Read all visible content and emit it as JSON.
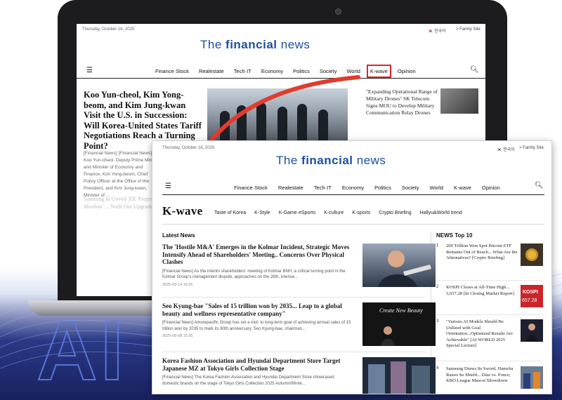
{
  "page_background": "#ffffff",
  "hero_overlay_text": "AI",
  "back_page": {
    "date": "Thursday, October 16, 2025",
    "lang": "🇰🇷 한국어",
    "family": "> Family Site",
    "logo_light": "The",
    "logo_bold": "financial",
    "logo_end": "news",
    "menu": [
      "Finance·Stock",
      "Realestate",
      "Tech·IT",
      "Economy",
      "Politics",
      "Society",
      "World",
      "K-wave",
      "Opinion"
    ],
    "selected_menu": "K-wave",
    "headline": "Koo Yun-cheol, Kim Yong-beom, and Kim Jung-kwan Visit the U.S. in Succession: Will Korea-United States Tariff Negotiations Reach a Turning Point?",
    "snippet": "[Financial News] [Financial News] Koo Yun-cheol, Deputy Prime Minister and Minister of Economy and Finance, Kim Yong-beom, Chief Policy Officer at the Office of the President, and Kim Jung-kwan, Minister of ...",
    "second_headline": "Samsung to Unveil XR 'Project Moohan' ... Nods Out Upgrade",
    "right_story": "\"Expanding Operational Range of Military Drones\" SK Telecom Signs MOU to Develop Military Communication Relay Drones"
  },
  "front_page": {
    "date": "Thursday, October 16, 2025",
    "lang": "🇰🇷 한국어",
    "family": "> Family Site",
    "logo_light": "The",
    "logo_bold": "financial",
    "logo_end": "news",
    "menu": [
      "Finance·Stock",
      "Realestate",
      "Tech·IT",
      "Economy",
      "Politics",
      "Society",
      "World",
      "K-wave",
      "Opinion"
    ],
    "section_title": "K-wave",
    "submenu": [
      "Taste of Korea",
      "K-Style",
      "K-Game·eSports",
      "K-culture",
      "K-sports",
      "Crypto Briefing",
      "Hallyu&World trend"
    ],
    "latest_label": "Latest News",
    "top_label": "NEWS Top 10",
    "latest": [
      {
        "title": "The 'Hostile M&A' Emerges in the Kolmar Incident, Strategic Moves Intensify Ahead of Shareholders' Meeting.. Concerns Over Physical Clashes",
        "summary": "[Financial News] As the interim shareholders' meeting of Kolmar BNH, a critical turning point in the Kolmar Group's management dispute, approaches on the 26th, intense...",
        "date": "2025-09-14 16:26"
      },
      {
        "title": "Seo Kyung-bae \"Sales of 15 trillion won by 2035... Leap to a global beauty and wellness representative company\"",
        "summary": "[Financial News] Amorepacific Group has set a mid- to long-term goal of achieving annual sales of 15 trillion won by 2035 to mark its 80th anniversary. Seo Kyung-bae, chairman...",
        "date": "2025-09-08 15:35"
      },
      {
        "title": "Korea Fashion Association and Hyundai Department Store Target Japanese MZ at Tokyo Girls Collection Stage",
        "summary": "[Financial News] The Korea Fashion Association and Hyundai Department Store showcased domestic brands on the stage of Tokyo Girls Collection 2025 Autumn/Winte...",
        "date": ""
      }
    ],
    "creative_caption": "Create New Beauty",
    "top10": [
      {
        "num": "1",
        "text": "200 Trillion Won Spot Bitcoin ETF Remains Out of Reach... What Are the Alternatives? [Crypto Briefing]"
      },
      {
        "num": "2",
        "text": "KOSPI Closes at All-Time High... 3,657.28 [In Closing Market Report]"
      },
      {
        "num": "3",
        "text": "\"Various AI Models Should Be Utilized with Goal Orientation...Optimized Results Are Achievable\" [AI WORLD 2025 Special Lecture]"
      },
      {
        "num": "4",
        "text": "Samsung Draws Its Sword, Hanwha Raises Its Shield... Diaz vs. Ponce; KBO League Mascot Showdown"
      }
    ],
    "kospi_text": "KOSPI",
    "kospi_value": "657.28"
  },
  "colors": {
    "brand_blue": "#1d4fa0",
    "highlight_red": "#e02626",
    "arrow_red": "#e23b2f"
  }
}
